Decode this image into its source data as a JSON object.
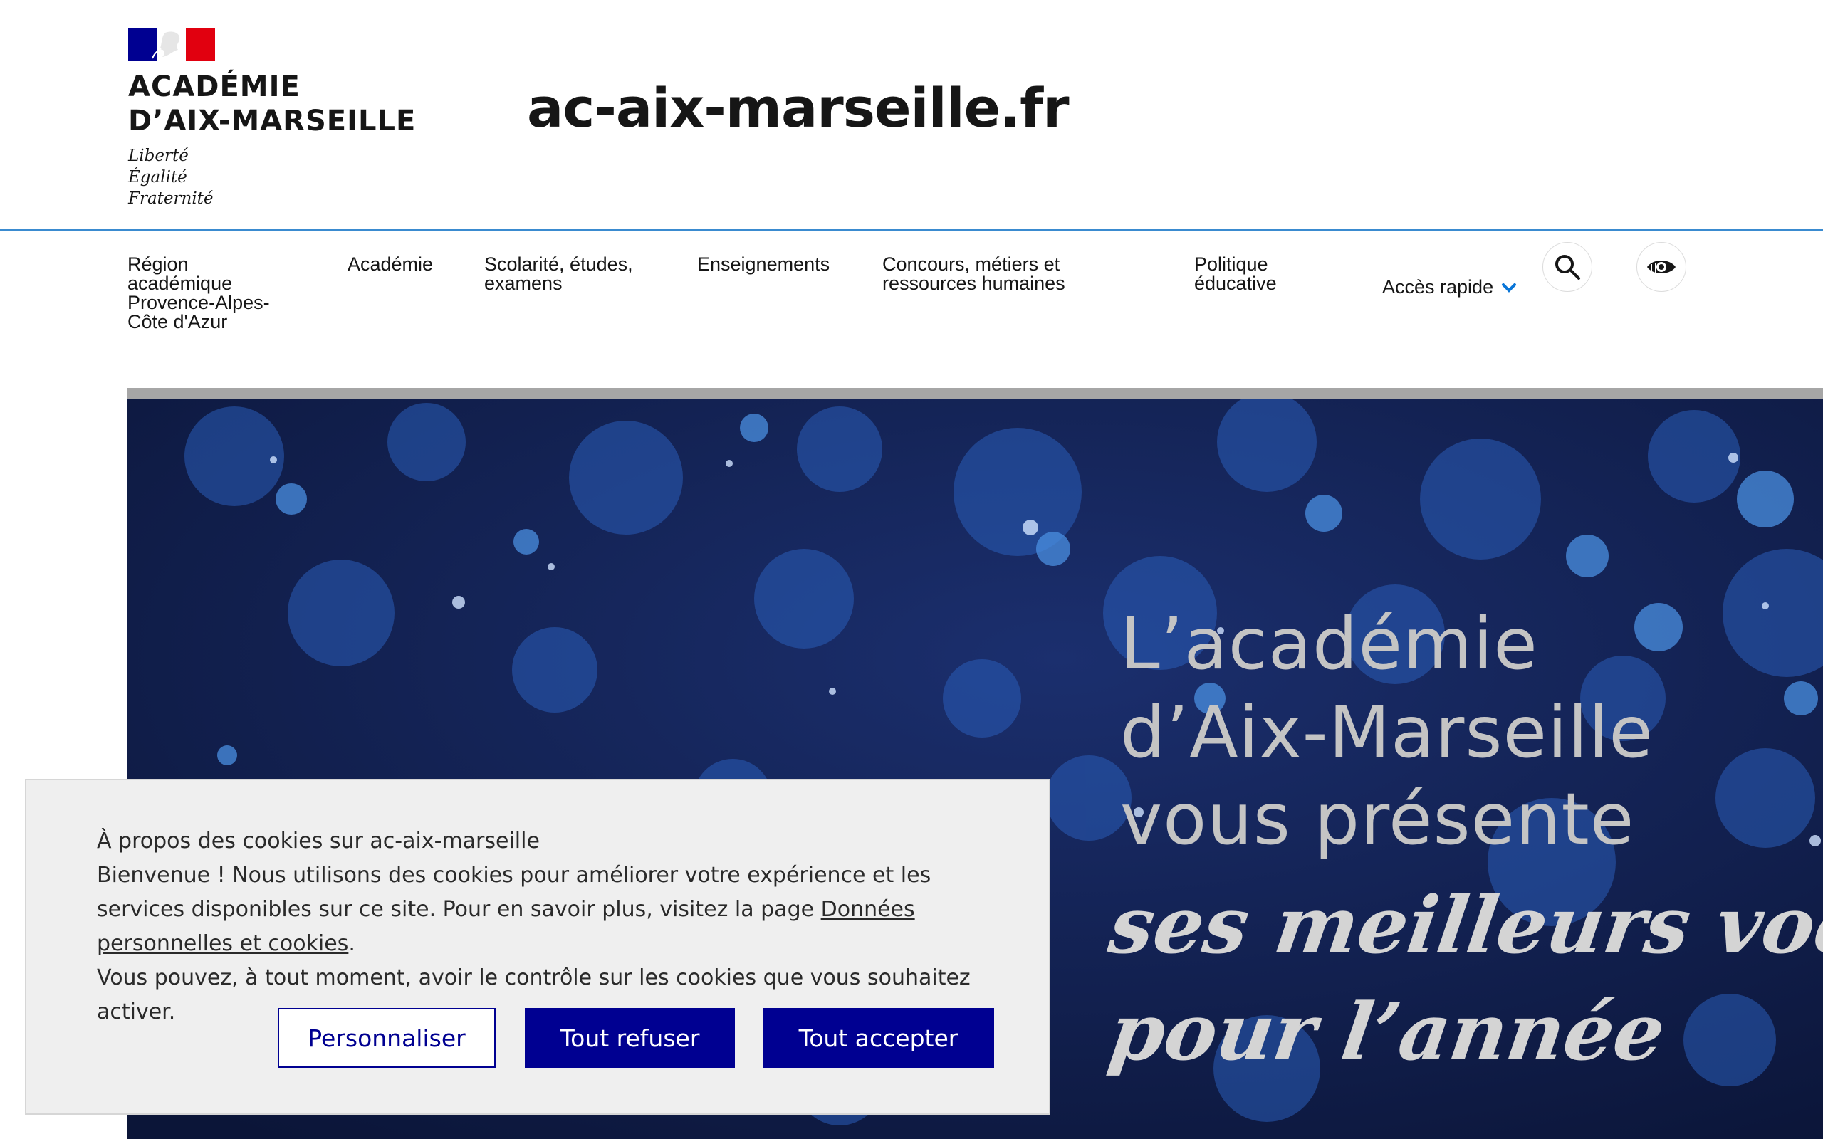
{
  "header": {
    "logo_name_line1": "ACADÉMIE",
    "logo_name_line2": "D’AIX-MARSEILLE",
    "motto": [
      "Liberté",
      "Égalité",
      "Fraternité"
    ],
    "site_title": "ac-aix-marseille.fr"
  },
  "nav": {
    "items": [
      {
        "label": "Région académique Provence-Alpes-Côte d'Azur"
      },
      {
        "label": "Académie"
      },
      {
        "label": "Scolarité, études, examens"
      },
      {
        "label": "Enseignements"
      },
      {
        "label": "Concours, métiers et ressources humaines"
      },
      {
        "label": "Politique éducative"
      }
    ],
    "quick_access": "Accès rapide",
    "search_icon": "search-icon",
    "accessibility_icon": "eye-icon"
  },
  "hero": {
    "line1": "L’académie",
    "line2": "d’Aix-Marseille",
    "line3": "vous présente",
    "script1": "ses meilleurs voeux",
    "script2": "pour l’année"
  },
  "cookie_banner": {
    "title": "À propos des cookies sur ac-aix-marseille",
    "text_before_link": "Bienvenue ! Nous utilisons des cookies pour améliorer votre expérience et les services disponibles sur ce site. Pour en savoir plus, visitez la page ",
    "link_text": "Données personnelles et cookies",
    "text_after_link": ".",
    "text_line_last": "Vous pouvez, à tout moment, avoir le contrôle sur les cookies que vous souhaitez activer.",
    "buttons": {
      "customize": "Personnaliser",
      "refuse_all": "Tout refuser",
      "accept_all": "Tout accepter"
    }
  },
  "colors": {
    "brand_blue": "#000091",
    "header_border": "#3a8bd0",
    "hero_background": "#0f1d4a",
    "banner_background": "#efefef"
  }
}
